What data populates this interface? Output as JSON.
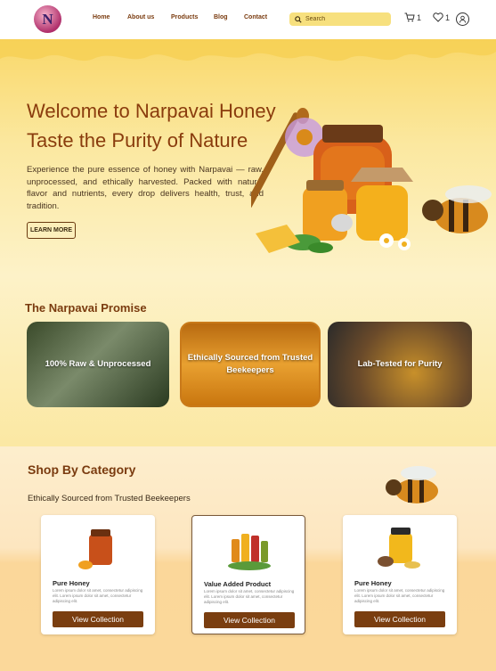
{
  "header": {
    "logo_letter": "N",
    "nav": [
      "Home",
      "About us",
      "Products",
      "Blog",
      "Contact"
    ],
    "search_placeholder": "Search",
    "cart_count": "1",
    "wishlist_count": "1"
  },
  "hero": {
    "title_line1": "Welcome to Narpavai Honey",
    "title_line2": "Taste the Purity of Nature",
    "description": "Experience the pure essence of honey with Narpavai — raw, unprocessed, and ethically harvested. Packed with natural flavor and nutrients, every drop delivers health, trust, and tradition.",
    "button_label": "LEARN MORE"
  },
  "promise": {
    "title": "The Narpavai Promise",
    "cards": [
      {
        "label": "100% Raw & Unprocessed"
      },
      {
        "label": "Ethically Sourced from Trusted Beekeepers"
      },
      {
        "label": "Lab-Tested for Purity"
      }
    ]
  },
  "category": {
    "title": "Shop By Category",
    "subtitle": "Ethically Sourced from Trusted Beekeepers",
    "cards": [
      {
        "name": "Pure Honey",
        "desc": "Lorem ipsum dolor sit amet, consectetur adipiscing elit. Lorem ipsum dolor sit amet, consectetur adipiscing elit.",
        "button": "View Collection"
      },
      {
        "name": "Value Added Product",
        "desc": "Lorem ipsum dolor sit amet, consectetur adipiscing elit. Lorem ipsum dolor sit amet, consectetur adipiscing elit.",
        "button": "View Collection"
      },
      {
        "name": "Pure Honey",
        "desc": "Lorem ipsum dolor sit amet, consectetur adipiscing elit. Lorem ipsum dolor sit amet, consectetur adipiscing elit.",
        "button": "View Collection"
      }
    ]
  },
  "colors": {
    "brand_brown": "#7a3b0f",
    "honey_yellow": "#f9d86a",
    "search_bg": "#f7e07e",
    "button_brown": "#7a3e10"
  },
  "icons": [
    "search-icon",
    "cart-icon",
    "heart-icon",
    "user-icon"
  ]
}
